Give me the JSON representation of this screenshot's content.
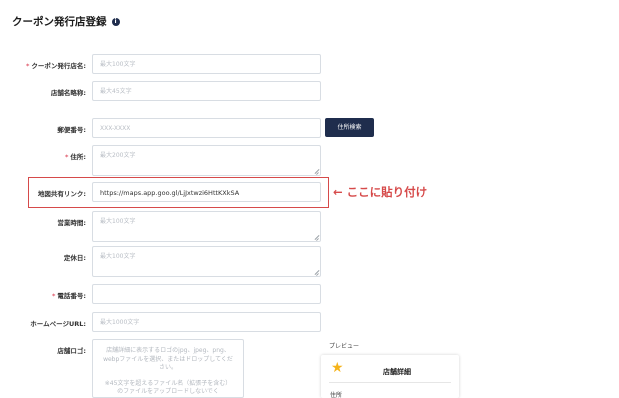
{
  "page_title": "クーポン発行店登録",
  "info_icon": "i",
  "form": {
    "shop_name": {
      "label": "クーポン発行店名:",
      "required": true,
      "placeholder": "最大100文字"
    },
    "shop_short": {
      "label": "店舗名略称:",
      "required": false,
      "placeholder": "最大45文字"
    },
    "postal": {
      "label": "郵便番号:",
      "required": false,
      "placeholder": "XXX-XXXX"
    },
    "search_button": "住所検索",
    "address": {
      "label": "住所:",
      "required": true,
      "placeholder": "最大200文字"
    },
    "map_link": {
      "label": "地図共有リンク:",
      "required": false,
      "value": "https://maps.app.goo.gl/LjJxtwzi6HttKXkSA"
    },
    "hours": {
      "label": "営業時間:",
      "required": false,
      "placeholder": "最大100文字"
    },
    "holidays": {
      "label": "定休日:",
      "required": false,
      "placeholder": "最大100文字"
    },
    "phone": {
      "label": "電話番号:",
      "required": true,
      "placeholder": ""
    },
    "homepage": {
      "label": "ホームページURL:",
      "required": false,
      "placeholder": "最大1000文字"
    },
    "logo": {
      "label": "店舗ロゴ:",
      "hint_1": "店舗詳細に表示するロゴのjpg、jpeg、png、webpファイルを選択、またはドロップしてください。",
      "hint_2": "※45文字を超えるファイル名（拡張子を含む）のファイルをアップロードしないでく"
    }
  },
  "annotation": "← ここに貼り付け",
  "preview": {
    "label": "プレビュー",
    "heading": "店舗詳細",
    "sub": "住所"
  },
  "colors": {
    "navy": "#1f2d4d",
    "required": "#e05a6b",
    "highlight": "#d64a4a",
    "star": "#f5b31a"
  }
}
